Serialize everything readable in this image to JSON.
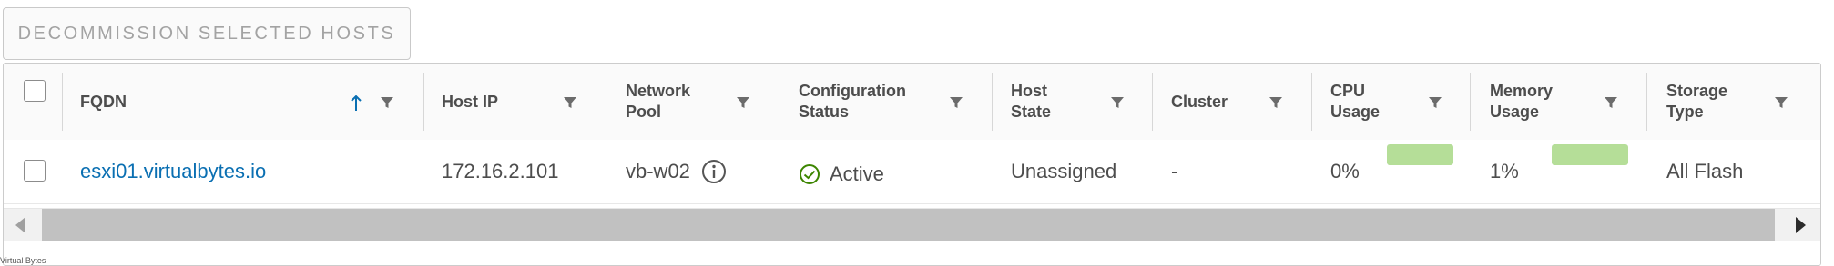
{
  "toolbar": {
    "decommission_label": "DECOMMISSION SELECTED HOSTS"
  },
  "columns": {
    "fqdn": "FQDN",
    "host_ip": "Host IP",
    "network_pool": "Network Pool",
    "config_status": "Configuration Status",
    "host_state": "Host State",
    "cluster": "Cluster",
    "cpu_usage": "CPU Usage",
    "memory_usage": "Memory Usage",
    "storage_type": "Storage Type"
  },
  "sort": {
    "column": "FQDN",
    "direction": "ascending"
  },
  "rows": [
    {
      "fqdn": "esxi01.virtualbytes.io",
      "host_ip": "172.16.2.101",
      "network_pool": "vb-w02",
      "config_status": "Active",
      "host_state": "Unassigned",
      "cluster": "-",
      "cpu_usage": "0%",
      "cpu_usage_fraction": 0.0,
      "memory_usage": "1%",
      "memory_usage_fraction": 0.01,
      "storage_type": "All Flash"
    }
  ],
  "colors": {
    "link": "#0a6fb2",
    "usage_bar": "#b5de98",
    "status_ok": "#3c8500",
    "sort_arrow": "#0a6fb2"
  },
  "icons": {
    "filter": "filter-icon",
    "sort": "sort-ascending-icon",
    "info": "info-icon",
    "status_ok": "check-circle-icon",
    "scroll_left": "scroll-left-icon",
    "scroll_right": "scroll-right-icon"
  },
  "footer": {
    "watermark": "Virtual Bytes"
  }
}
